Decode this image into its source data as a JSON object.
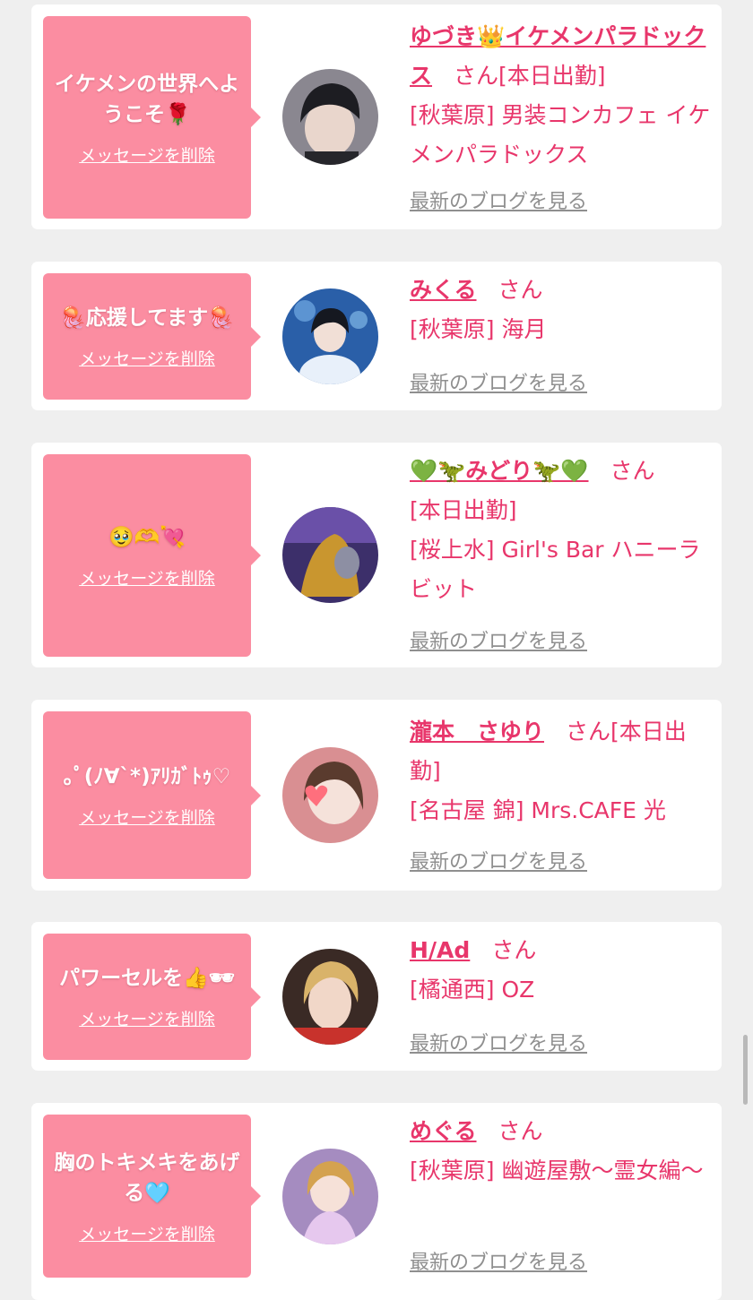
{
  "colors": {
    "accent": "#e8366b",
    "bubble": "#fb8da1",
    "link_grey": "#8f8f8f",
    "background": "#efefef"
  },
  "delete_label": "メッセージを削除",
  "blog_label": "最新のブログを見る",
  "san_label": "さん",
  "cards": [
    {
      "message": "イケメンの世界へようこそ🌹",
      "name": "ゆづき👑イケメンパラドックス",
      "status": "[本日出勤]",
      "shop": "[秋葉原] 男装コンカフェ イケメンパラドックス",
      "avatar": "dark-haired-cast-photo"
    },
    {
      "message": "🪼応援してます🪼",
      "name": "みくる",
      "status": "",
      "shop": "[秋葉原] 海月",
      "avatar": "jellyfish-aquarium-cast-photo"
    },
    {
      "message": "🥹🫶💘",
      "name": "💚🦖みどり🦖💚",
      "status": "[本日出勤]",
      "shop": "[桜上水] Girl's Bar ハニーラビット",
      "avatar": "purple-room-cast-photo"
    },
    {
      "message": "｡ﾟ(ﾉ∀`*)ｱﾘｶﾞﾄｩ♡",
      "name": "瀧本　さゆり",
      "status": "[本日出勤]",
      "shop": "[名古屋 錦] Mrs.CAFE 光",
      "avatar": "heart-cast-photo"
    },
    {
      "message": "パワーセルを👍🕶",
      "name": "H/Ad",
      "status": "",
      "shop": "[橘通西] OZ",
      "avatar": "blonde-cast-photo"
    },
    {
      "message": "胸のトキメキをあげる🩵",
      "name": "めぐる",
      "status": "",
      "shop": "[秋葉原] 幽遊屋敷～霊女編～",
      "avatar": "pink-dress-cast-photo"
    }
  ]
}
